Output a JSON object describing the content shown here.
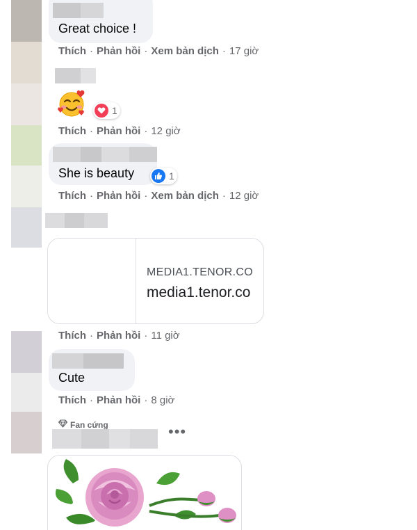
{
  "comments": [
    {
      "text": "Great choice !",
      "actions": {
        "like": "Thích",
        "reply": "Phản hồi",
        "translate": "Xem bản dịch",
        "time": "17 giờ"
      }
    },
    {
      "emoji_icon": "smiling-face-with-hearts-icon",
      "reaction": {
        "icon": "love-reaction-icon",
        "count": "1",
        "color": "#f33e58"
      },
      "actions": {
        "like": "Thích",
        "reply": "Phản hồi",
        "time": "12 giờ"
      }
    },
    {
      "text": "She is beauty",
      "reaction": {
        "icon": "like-reaction-icon",
        "count": "1",
        "color": "#1877f2"
      },
      "actions": {
        "like": "Thích",
        "reply": "Phản hồi",
        "translate": "Xem bản dịch",
        "time": "12 giờ"
      }
    },
    {
      "link_preview": {
        "domain_caps": "MEDIA1.TENOR.CO",
        "domain": "media1.tenor.co"
      },
      "actions": {
        "like": "Thích",
        "reply": "Phản hồi",
        "time": "11 giờ"
      }
    },
    {
      "text": "Cute",
      "actions": {
        "like": "Thích",
        "reply": "Phản hồi",
        "time": "8 giờ"
      }
    },
    {
      "badge": {
        "icon": "diamond-icon",
        "label": "Fan cứng"
      },
      "more_icon": "more-options-icon",
      "sticker_icon": "pink-rose-sticker-icon"
    }
  ],
  "separator": "·"
}
